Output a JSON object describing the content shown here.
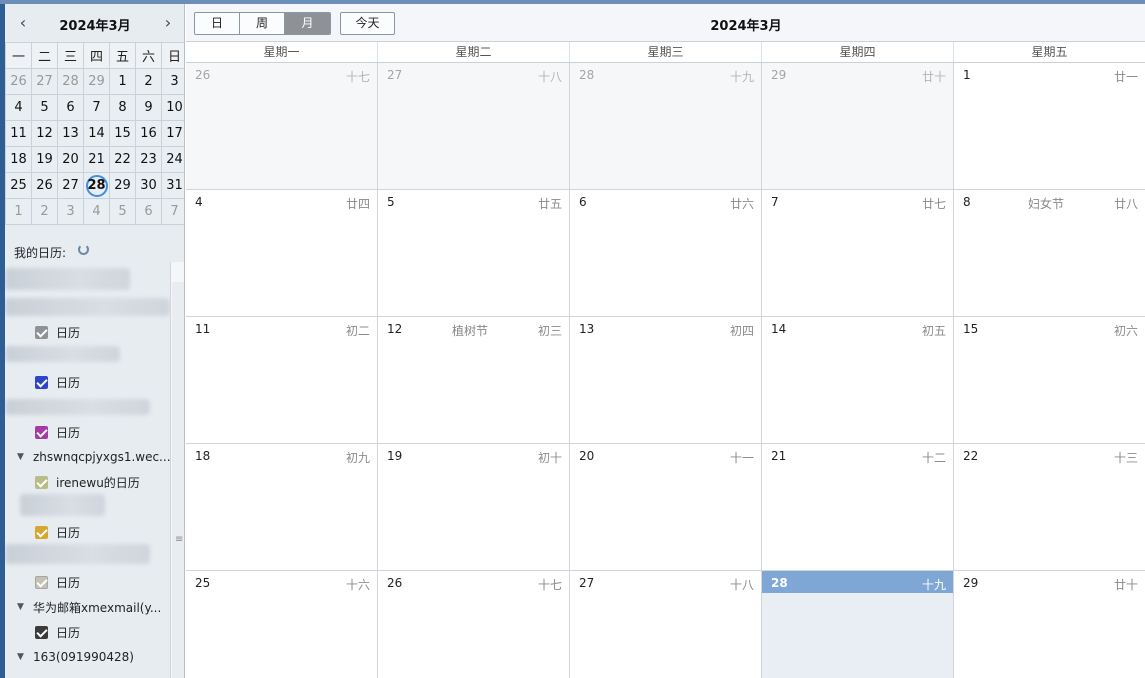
{
  "mini_calendar": {
    "prev_icon": "‹",
    "next_icon": "›",
    "title": "2024年3月",
    "weekdays": [
      "一",
      "二",
      "三",
      "四",
      "五",
      "六",
      "日"
    ],
    "weeks": [
      [
        "26",
        "27",
        "28",
        "29",
        "1",
        "2",
        "3"
      ],
      [
        "4",
        "5",
        "6",
        "7",
        "8",
        "9",
        "10"
      ],
      [
        "11",
        "12",
        "13",
        "14",
        "15",
        "16",
        "17"
      ],
      [
        "18",
        "19",
        "20",
        "21",
        "22",
        "23",
        "24"
      ],
      [
        "25",
        "26",
        "27",
        "28",
        "29",
        "30",
        "31"
      ],
      [
        "1",
        "2",
        "3",
        "4",
        "5",
        "6",
        "7"
      ]
    ]
  },
  "sidebar": {
    "my_calendars_label": "我的日历:",
    "items": [
      {
        "name": "日历",
        "color": "#8f9398"
      },
      {
        "name": "日历",
        "color": "#2f45c8"
      },
      {
        "name": "日历",
        "color": "#a63aa5"
      },
      {
        "group": "zhswnqcpjyxgs1.wec..."
      },
      {
        "name": "irenewu的日历",
        "color": "#b8bd86"
      },
      {
        "name": "日历",
        "color": "#d9a532"
      },
      {
        "name": "日历",
        "color": "#c4c1b8"
      },
      {
        "group": "华为邮箱xmexmail(y..."
      },
      {
        "name": "日历",
        "color": "#3b3b3b"
      },
      {
        "group": "163(091990428)"
      }
    ]
  },
  "toolbar": {
    "views": [
      "日",
      "周",
      "月"
    ],
    "active_view": "月",
    "today_label": "今天",
    "title": "2024年3月"
  },
  "month_view": {
    "weekdays": [
      "星期一",
      "星期二",
      "星期三",
      "星期四",
      "星期五"
    ],
    "weeks": [
      [
        {
          "day": "26",
          "lunar": "十七",
          "other": true
        },
        {
          "day": "27",
          "lunar": "十八",
          "other": true
        },
        {
          "day": "28",
          "lunar": "十九",
          "other": true
        },
        {
          "day": "29",
          "lunar": "廿十",
          "other": true
        },
        {
          "day": "1",
          "lunar": "廿一"
        }
      ],
      [
        {
          "day": "4",
          "lunar": "廿四"
        },
        {
          "day": "5",
          "lunar": "廿五"
        },
        {
          "day": "6",
          "lunar": "廿六"
        },
        {
          "day": "7",
          "lunar": "廿七"
        },
        {
          "day": "8",
          "lunar": "廿八",
          "festival": "妇女节"
        }
      ],
      [
        {
          "day": "11",
          "lunar": "初二"
        },
        {
          "day": "12",
          "lunar": "初三",
          "festival": "植树节"
        },
        {
          "day": "13",
          "lunar": "初四"
        },
        {
          "day": "14",
          "lunar": "初五"
        },
        {
          "day": "15",
          "lunar": "初六"
        }
      ],
      [
        {
          "day": "18",
          "lunar": "初九"
        },
        {
          "day": "19",
          "lunar": "初十"
        },
        {
          "day": "20",
          "lunar": "十一"
        },
        {
          "day": "21",
          "lunar": "十二"
        },
        {
          "day": "22",
          "lunar": "十三"
        }
      ],
      [
        {
          "day": "25",
          "lunar": "十六"
        },
        {
          "day": "26",
          "lunar": "十七"
        },
        {
          "day": "27",
          "lunar": "十八"
        },
        {
          "day": "28",
          "lunar": "十九",
          "today": true
        },
        {
          "day": "29",
          "lunar": "廿十"
        }
      ]
    ]
  },
  "colors": {
    "today_bar": "#7ea7d6",
    "today_circle": "#3f8fe0",
    "active_view": "#8e9297"
  }
}
